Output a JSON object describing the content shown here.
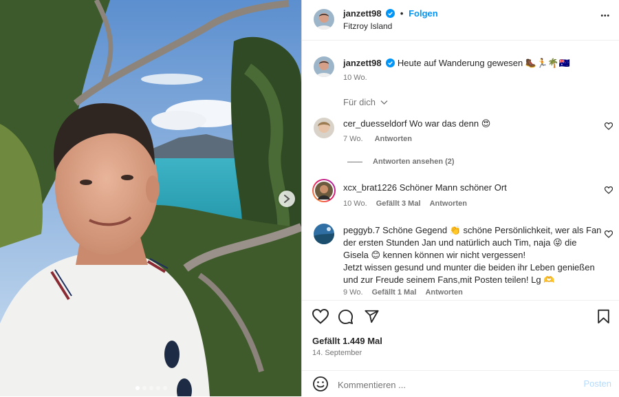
{
  "post": {
    "author": "janzett98",
    "location": "Fitzroy Island",
    "follow_label": "Folgen",
    "separator": "•",
    "caption": "Heute auf Wanderung gewesen",
    "caption_emojis": "🥾🏃🌴🇦🇺",
    "caption_age": "10 Wo.",
    "menu_glyph": "•••"
  },
  "comments_section": {
    "filter_label": "Für dich",
    "items": [
      {
        "user": "cer_duesseldorf",
        "text": "Wo war das denn",
        "emoji": "😍",
        "age": "7 Wo.",
        "reply_label": "Antworten",
        "view_replies": "Antworten ansehen (2)"
      },
      {
        "user": "xcx_brat1226",
        "text": "Schöner Mann schöner Ort",
        "age": "10 Wo.",
        "likes": "Gefällt 3 Mal",
        "reply_label": "Antworten"
      },
      {
        "user": "peggyb.7",
        "line1": "Schöne Gegend",
        "line1b": "schöne Persönlichkeit, wer als Fan",
        "line2a": "der ersten Stunden Jan und natürlich auch Tim, naja",
        "line2b": "die",
        "line3a": "Gisela",
        "line3b": "kennen können wir nicht vergessen!",
        "line4": "Jetzt wissen gesund und munter die beiden ihr Leben genießen",
        "line5": "und zur Freude seinem Fans,mit Posten teilen! Lg",
        "age": "9 Wo.",
        "likes": "Gefällt 1 Mal",
        "reply_label": "Antworten"
      }
    ]
  },
  "stats": {
    "likes": "Gefällt 1.449 Mal",
    "date": "14. September"
  },
  "composer": {
    "placeholder": "Kommentieren ...",
    "post_label": "Posten"
  },
  "carousel": {
    "slides": 5,
    "active": 1
  },
  "colors": {
    "accent": "#0095f6",
    "muted": "#737373",
    "text": "#262626"
  }
}
